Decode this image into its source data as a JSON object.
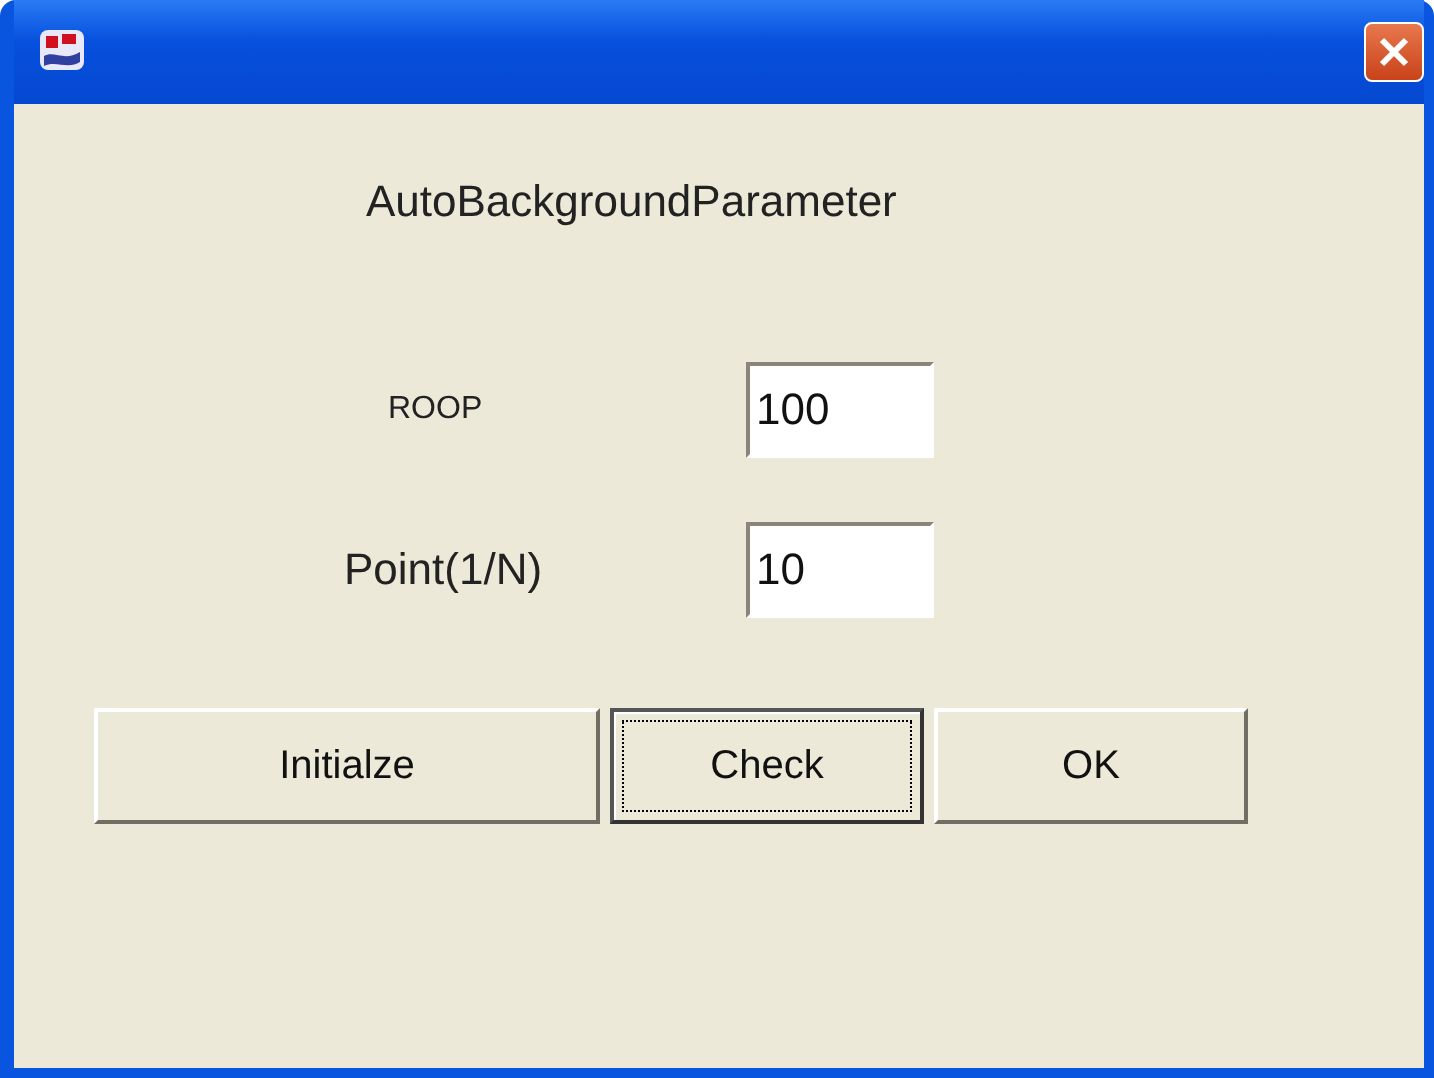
{
  "dialog": {
    "heading": "AutoBackgroundParameter"
  },
  "fields": [
    {
      "label": "ROOP",
      "value": "100",
      "kind": "small"
    },
    {
      "label": "Point(1/N)",
      "value": "10",
      "kind": "large"
    }
  ],
  "buttons": [
    {
      "label": "Initialze",
      "focused": false,
      "kind": "wide"
    },
    {
      "label": "Check",
      "focused": true,
      "kind": "normal"
    },
    {
      "label": "OK",
      "focused": false,
      "kind": "normal"
    }
  ]
}
